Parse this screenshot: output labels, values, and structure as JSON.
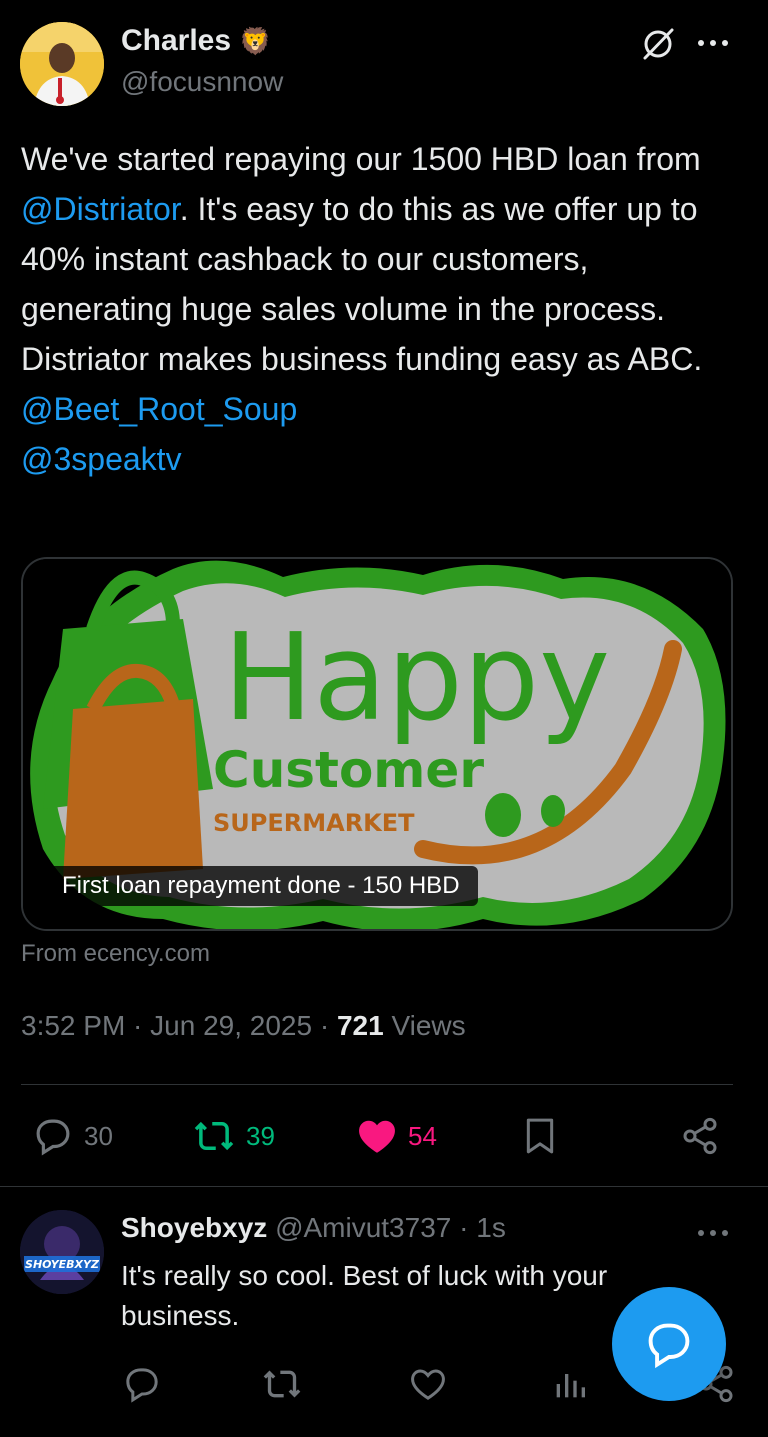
{
  "tweet": {
    "author_name": "Charles",
    "author_emoji": "🦁",
    "author_handle": "@focusnnow",
    "text_parts": [
      {
        "type": "text",
        "value": "We've started repaying our 1500 HBD loan from "
      },
      {
        "type": "mention",
        "value": "@Distriator"
      },
      {
        "type": "text",
        "value": ". It's easy to do this as we offer up to 40% instant cashback to our customers, generating huge sales volume in the process. Distriator makes business funding easy as ABC."
      }
    ],
    "mentions_lines": [
      "@Beet_Root_Soup",
      "@3speaktv"
    ],
    "card": {
      "logo_word_1": "Happy",
      "logo_word_2": "Customer",
      "logo_word_3": "SUPERMARKET",
      "caption": "First loan repayment done - 150 HBD"
    },
    "source": "From ecency.com",
    "timestamp": "3:52 PM · Jun 29, 2025 · ",
    "views_count": "721",
    "views_label": " Views",
    "stats": {
      "replies": "30",
      "reposts": "39",
      "likes": "54"
    }
  },
  "reply": {
    "name": "Shoyebxyz",
    "handle": "@Amivut3737",
    "time": " · 1s",
    "avatar_text": "SHOYEBXYZ",
    "text": "It's really so cool. Best of luck with your business."
  },
  "colors": {
    "accent": "#1d9bf0",
    "repost": "#00ba7c",
    "like": "#f91880",
    "muted": "#71767b",
    "background": "#000000"
  },
  "icons": [
    "grok-icon",
    "more-icon",
    "reply-icon",
    "repost-icon",
    "like-icon",
    "bookmark-icon",
    "share-icon",
    "views-icon",
    "compose-reply-icon"
  ]
}
